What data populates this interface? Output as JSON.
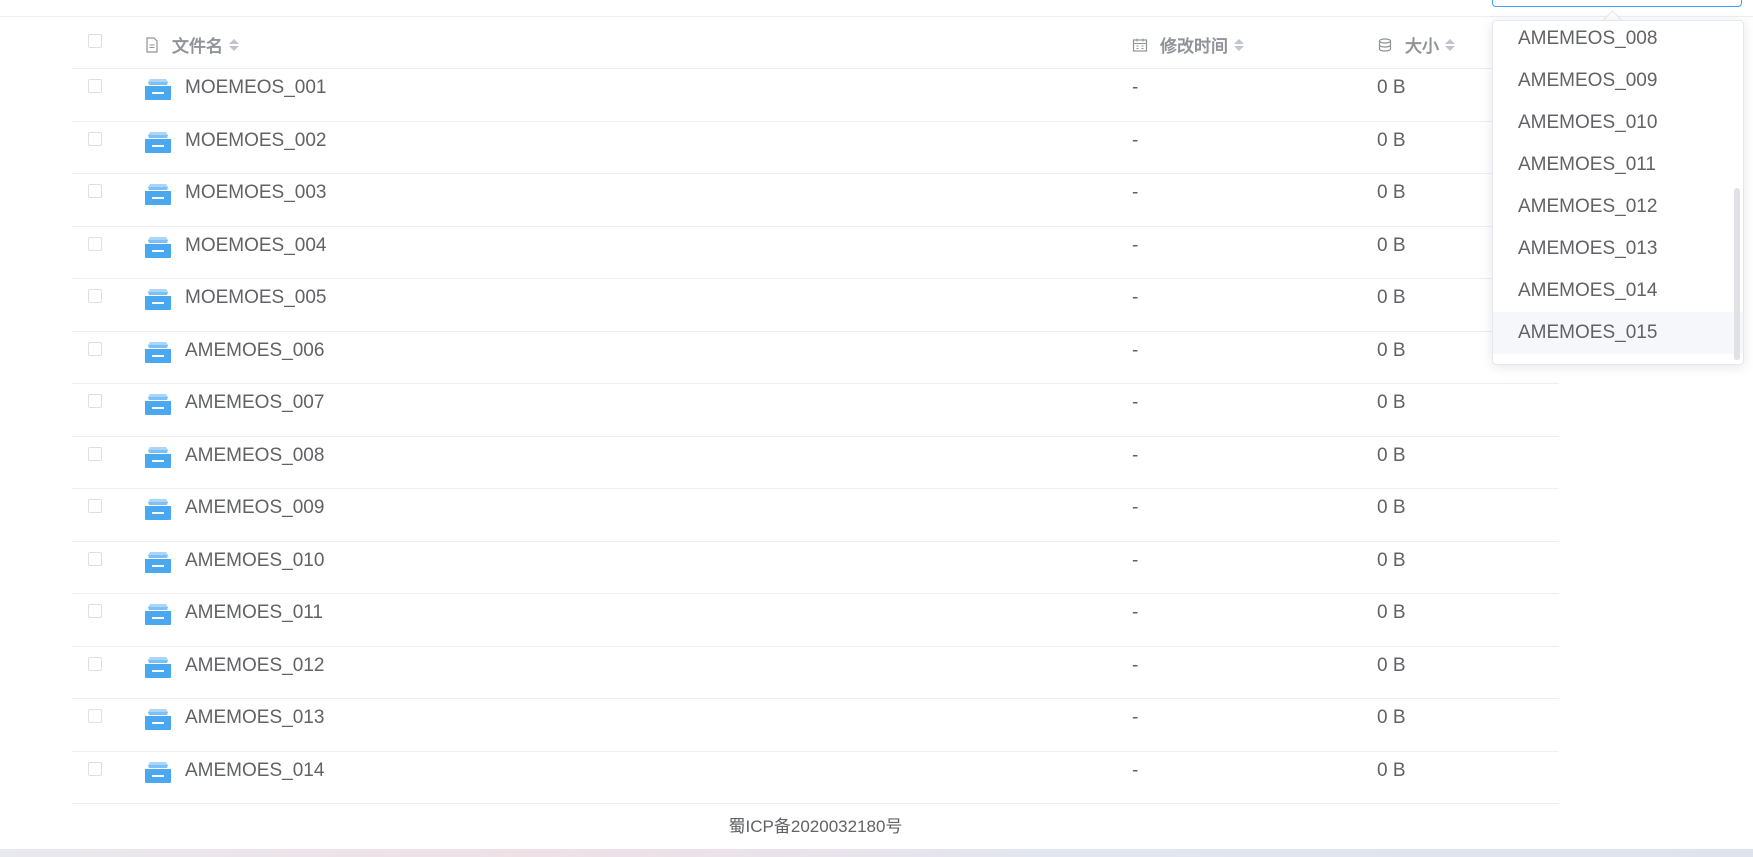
{
  "table": {
    "headers": {
      "name": "文件名",
      "modified": "修改时间",
      "size": "大小"
    },
    "rows": [
      {
        "name": "MOEMEOS_001",
        "modified": "-",
        "size": "0 B"
      },
      {
        "name": "MOEMOES_002",
        "modified": "-",
        "size": "0 B"
      },
      {
        "name": "MOEMOES_003",
        "modified": "-",
        "size": "0 B"
      },
      {
        "name": "MOEMOES_004",
        "modified": "-",
        "size": "0 B"
      },
      {
        "name": "MOEMOES_005",
        "modified": "-",
        "size": "0 B"
      },
      {
        "name": "AMEMOES_006",
        "modified": "-",
        "size": "0 B"
      },
      {
        "name": "AMEMEOS_007",
        "modified": "-",
        "size": "0 B"
      },
      {
        "name": "AMEMEOS_008",
        "modified": "-",
        "size": "0 B"
      },
      {
        "name": "AMEMEOS_009",
        "modified": "-",
        "size": "0 B"
      },
      {
        "name": "AMEMOES_010",
        "modified": "-",
        "size": "0 B"
      },
      {
        "name": "AMEMOES_011",
        "modified": "-",
        "size": "0 B"
      },
      {
        "name": "AMEMOES_012",
        "modified": "-",
        "size": "0 B"
      },
      {
        "name": "AMEMOES_013",
        "modified": "-",
        "size": "0 B"
      },
      {
        "name": "AMEMOES_014",
        "modified": "-",
        "size": "0 B"
      }
    ]
  },
  "dropdown": {
    "items": [
      "AMEMEOS_008",
      "AMEMEOS_009",
      "AMEMOES_010",
      "AMEMOES_011",
      "AMEMOES_012",
      "AMEMOES_013",
      "AMEMOES_014",
      "AMEMOES_015"
    ],
    "hovered_index": 7
  },
  "footer": {
    "icp": "蜀ICP备2020032180号"
  },
  "icons": {
    "folder": "folder-icon",
    "file": "file-icon",
    "calendar": "calendar-icon",
    "storage": "database-icon"
  },
  "colors": {
    "folder": "#4aa8f0",
    "accent": "#409eff",
    "header_text": "#909399",
    "body_text": "#606266"
  }
}
